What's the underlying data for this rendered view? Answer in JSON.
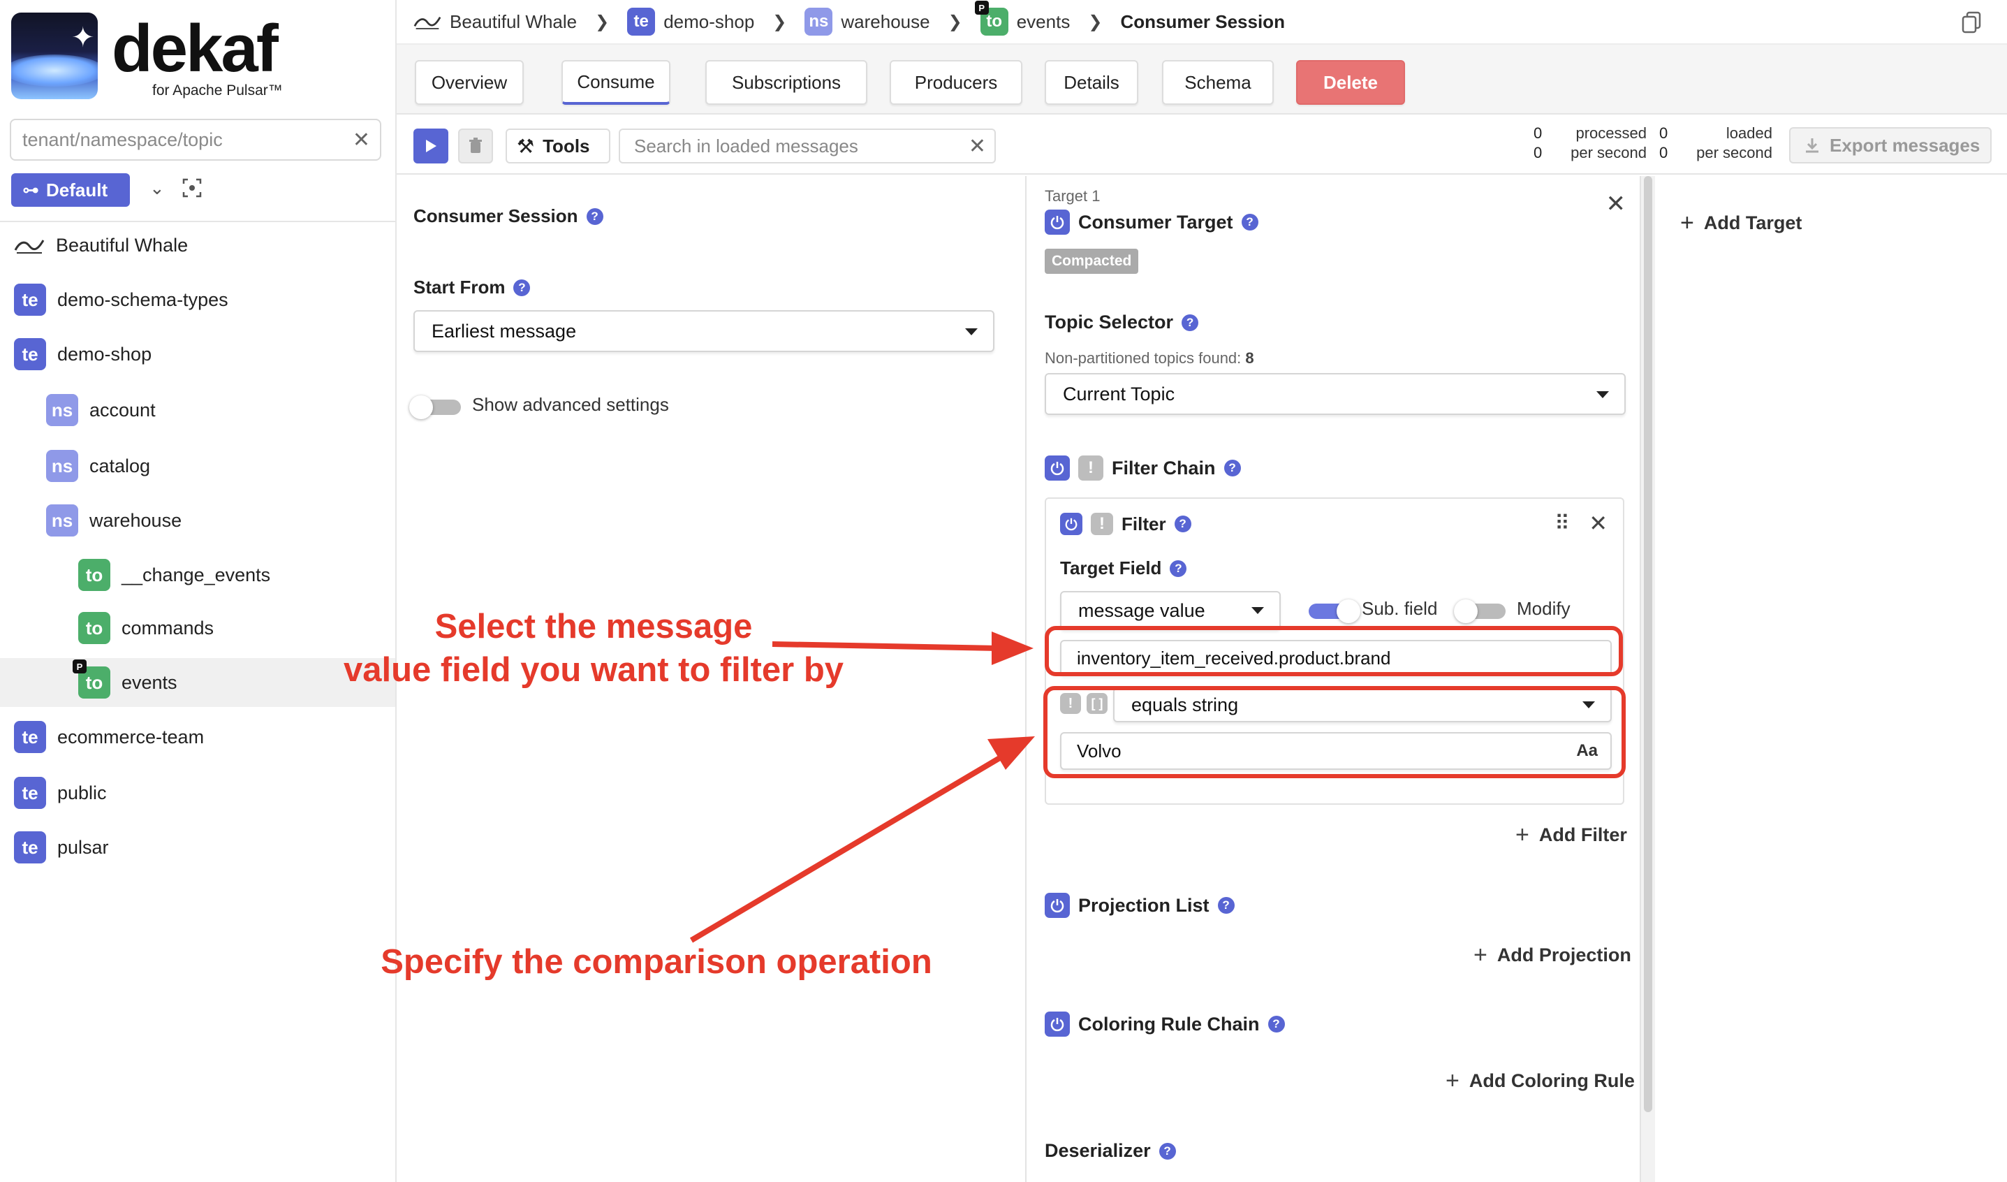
{
  "sidebar": {
    "brand": "dekaf",
    "brand_sub": "for Apache Pulsar™",
    "search_placeholder": "tenant/namespace/topic",
    "default_button": "Default",
    "tree": [
      {
        "badge": "",
        "label": "Beautiful Whale"
      },
      {
        "badge": "te",
        "label": "demo-schema-types"
      },
      {
        "badge": "te",
        "label": "demo-shop"
      },
      {
        "badge": "ns",
        "label": "account"
      },
      {
        "badge": "ns",
        "label": "catalog"
      },
      {
        "badge": "ns",
        "label": "warehouse"
      },
      {
        "badge": "to",
        "label": "__change_events"
      },
      {
        "badge": "to",
        "label": "commands"
      },
      {
        "badge": "to",
        "label": "events",
        "pbadge": "P"
      },
      {
        "badge": "te",
        "label": "ecommerce-team"
      },
      {
        "badge": "te",
        "label": "public"
      },
      {
        "badge": "te",
        "label": "pulsar"
      }
    ]
  },
  "breadcrumb": [
    {
      "badge": "",
      "label": "Beautiful Whale"
    },
    {
      "badge": "te",
      "label": "demo-shop"
    },
    {
      "badge": "ns",
      "label": "warehouse"
    },
    {
      "badge": "to",
      "label": "events",
      "pbadge": "P"
    },
    {
      "badge": "",
      "label": "Consumer Session"
    }
  ],
  "tabs": [
    "Overview",
    "Consume",
    "Subscriptions",
    "Producers",
    "Details",
    "Schema",
    "Delete"
  ],
  "toolbar": {
    "tools_label": "Tools",
    "search_placeholder": "Search in loaded messages",
    "processed_count": "0",
    "processed_rate": "0",
    "processed_label": "processed",
    "loaded_count": "0",
    "loaded_rate": "0",
    "loaded_label": "loaded",
    "per_second_label": "per second",
    "export_label": "Export messages"
  },
  "session": {
    "title": "Consumer Session",
    "start_from_label": "Start From",
    "start_from_value": "Earliest message",
    "advanced_label": "Show advanced settings"
  },
  "target": {
    "index_label": "Target 1",
    "title": "Consumer Target",
    "compacted_badge": "Compacted",
    "topic_selector_label": "Topic Selector",
    "topics_found_label": "Non-partitioned topics found:",
    "topics_found_count": "8",
    "topic_selector_value": "Current Topic",
    "filter_chain_label": "Filter Chain",
    "filter_label": "Filter",
    "target_field_label": "Target Field",
    "target_field_value": "message value",
    "sub_field_label": "Sub. field",
    "modify_label": "Modify",
    "field_path": "inventory_item_received.product.brand",
    "operation": "equals string",
    "compare_value": "Volvo",
    "case_toggle": "Aa",
    "add_filter": "Add Filter",
    "projection_label": "Projection List",
    "add_projection": "Add Projection",
    "coloring_label": "Coloring Rule Chain",
    "add_coloring": "Add Coloring Rule",
    "deserializer_label": "Deserializer"
  },
  "add_target": "Add Target",
  "annotations": {
    "line1": "Select the message",
    "line2": "value field you want to filter by",
    "line3": "Specify the comparison operation"
  },
  "colors": {
    "accent": "#5865d3",
    "namespace": "#8f99e8",
    "topic": "#4cae6a",
    "danger": "#e87474",
    "annotation": "#e53a2b"
  }
}
